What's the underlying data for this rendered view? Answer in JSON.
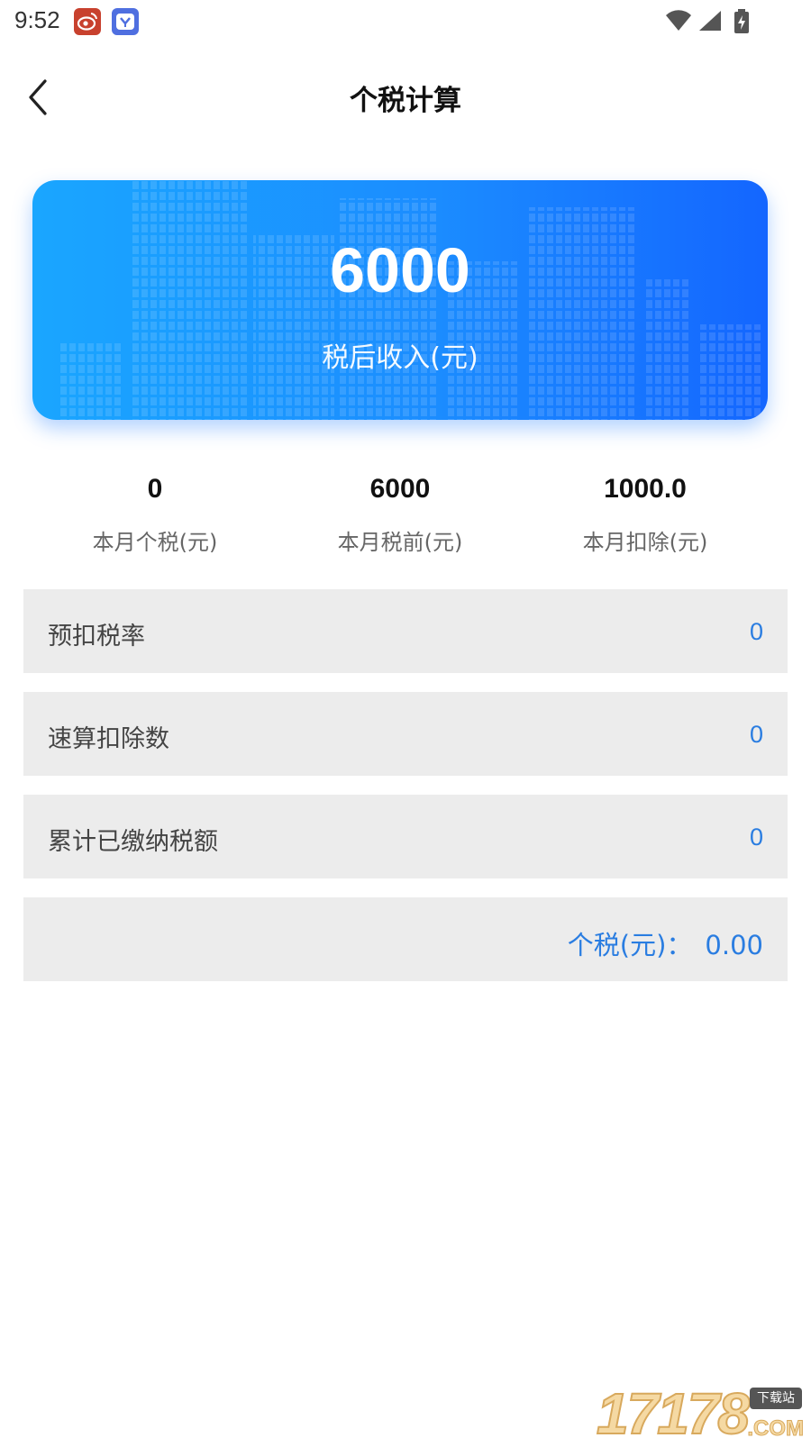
{
  "status_bar": {
    "time": "9:52",
    "notifications": [
      "weibo-icon",
      "app-notification-icon"
    ],
    "indicators": [
      "wifi-icon",
      "signal-icon",
      "battery-charging-icon"
    ]
  },
  "header": {
    "title": "个税计算",
    "back_icon": "chevron-left-icon"
  },
  "hero": {
    "value": "6000",
    "label": "税后收入(元)",
    "gradient": [
      "#1aa6ff",
      "#1466ff"
    ]
  },
  "stats": [
    {
      "value": "0",
      "label": "本月个税(元)"
    },
    {
      "value": "6000",
      "label": "本月税前(元)"
    },
    {
      "value": "1000.0",
      "label": "本月扣除(元)"
    }
  ],
  "rows": [
    {
      "label": "预扣税率",
      "value": "0"
    },
    {
      "label": "速算扣除数",
      "value": "0"
    },
    {
      "label": "累计已缴纳税额",
      "value": "0"
    }
  ],
  "total": {
    "label": "个税(元)：",
    "value": "0.00"
  },
  "colors": {
    "accent": "#2a7de1",
    "row_bg": "#ececec"
  },
  "watermark": {
    "digits": "17178",
    "badge": "下载站",
    "suffix": ".COM"
  }
}
